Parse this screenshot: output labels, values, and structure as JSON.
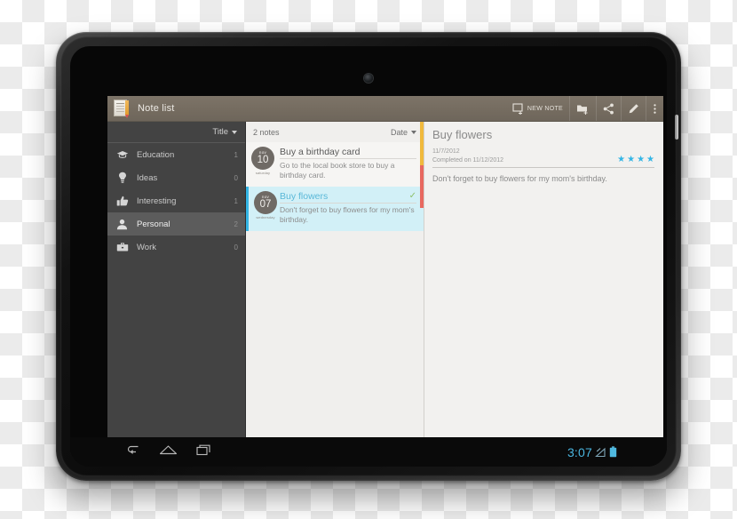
{
  "app": {
    "title": "Note list",
    "icon": "notepad-icon"
  },
  "action_bar": {
    "new_note_label": "NEW NOTE",
    "buttons": [
      {
        "name": "new-note",
        "label": "NEW NOTE",
        "icon": "note-add-icon"
      },
      {
        "name": "new-folder",
        "label": "",
        "icon": "folder-add-icon"
      },
      {
        "name": "share",
        "label": "",
        "icon": "share-icon"
      },
      {
        "name": "edit",
        "label": "",
        "icon": "pencil-icon"
      },
      {
        "name": "overflow",
        "label": "",
        "icon": "overflow-menu-icon"
      }
    ]
  },
  "sidebar": {
    "sort_label": "Title",
    "sort_icon": "chevron-down-icon",
    "items": [
      {
        "label": "Education",
        "count": "1",
        "icon": "graduation-cap-icon",
        "active": false
      },
      {
        "label": "Ideas",
        "count": "0",
        "icon": "lightbulb-icon",
        "active": false
      },
      {
        "label": "Interesting",
        "count": "1",
        "icon": "thumbs-up-icon",
        "active": false
      },
      {
        "label": "Personal",
        "count": "2",
        "icon": "person-icon",
        "active": true
      },
      {
        "label": "Work",
        "count": "0",
        "icon": "briefcase-icon",
        "active": false
      }
    ]
  },
  "notes_pane": {
    "count_label": "2 notes",
    "sort_label": "Date",
    "sort_icon": "chevron-down-icon",
    "notes": [
      {
        "month": "nov",
        "day": "10",
        "weekday": "saturday",
        "title": "Buy a birthday card",
        "snippet": "Go to the local book store to buy a birthday card.",
        "completed": false,
        "strip_color": "#f0b93c",
        "selected": false
      },
      {
        "month": "nov",
        "day": "07",
        "weekday": "wednesday",
        "title": "Buy flowers",
        "snippet": "Don't forget to buy flowers for my mom's birthday.",
        "completed": true,
        "check_icon": "checkmark-icon",
        "strip_color": "#e8685f",
        "selected": true
      }
    ]
  },
  "detail": {
    "title": "Buy flowers",
    "created": "11/7/2012",
    "completed": "Completed on 11/12/2012",
    "rating": 4,
    "star_glyph": "★",
    "star_color": "#33b5e5",
    "body": "Don't forget to buy flowers for my mom's birthday."
  },
  "navbar": {
    "back_icon": "back-arrow-icon",
    "home_icon": "home-icon",
    "recents_icon": "recent-apps-icon",
    "clock": "3:07",
    "signal_icon": "signal-icon",
    "battery_icon": "battery-icon"
  }
}
